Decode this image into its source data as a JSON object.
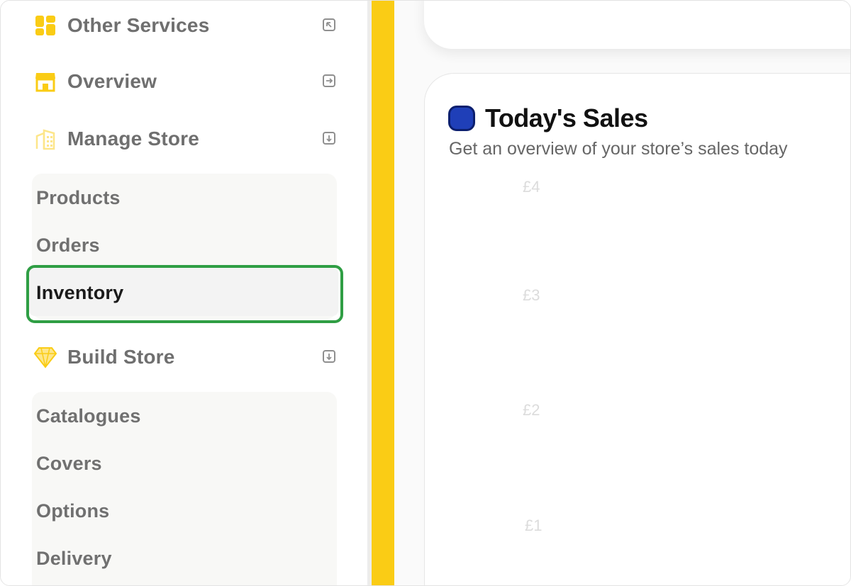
{
  "colors": {
    "accent_yellow": "#facc15",
    "selection_outline": "#2f9e44",
    "sales_badge": "#1f3fb8"
  },
  "sidebar": {
    "nav": [
      {
        "label": "Other Services",
        "icon": "grid-icon",
        "trail_icon": "external-link-icon"
      },
      {
        "label": "Overview",
        "icon": "storefront-icon",
        "trail_icon": "arrow-right-box-icon"
      },
      {
        "label": "Manage Store",
        "icon": "building-icon",
        "trail_icon": "chevron-down-box-icon"
      },
      {
        "label": "Build Store",
        "icon": "diamond-icon",
        "trail_icon": "chevron-down-box-icon"
      }
    ],
    "manage_store_items": [
      "Products",
      "Orders",
      "Inventory"
    ],
    "active_item": "Inventory",
    "build_store_items": [
      "Catalogues",
      "Covers",
      "Options",
      "Delivery"
    ]
  },
  "sales": {
    "title": "Today's Sales",
    "subtitle": "Get an overview of your store’s sales today"
  },
  "chart_data": {
    "type": "bar",
    "title": "Today's Sales",
    "y_ticks": [
      "£4",
      "£3",
      "£2",
      "£1"
    ],
    "categories": [],
    "series": []
  }
}
